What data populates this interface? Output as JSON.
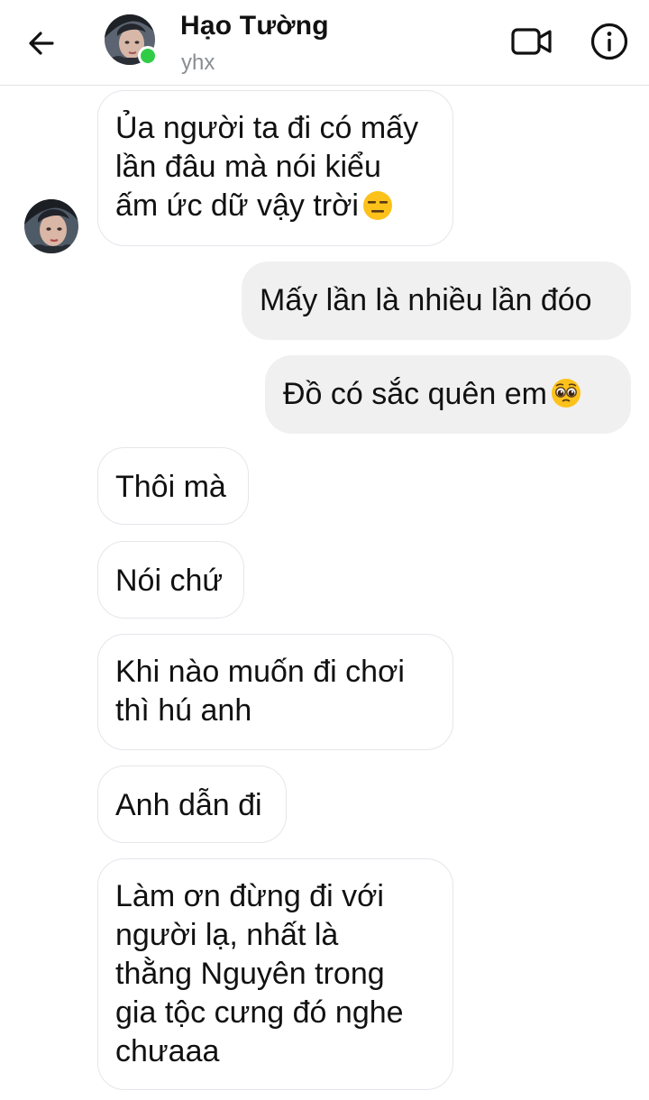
{
  "header": {
    "contact_name": "Hạo Tường",
    "contact_subtitle": "yhx",
    "online": true
  },
  "icons": {
    "back": "arrow-left",
    "video": "video-camera",
    "info": "info-circle"
  },
  "colors": {
    "online": "#31cc46",
    "incoming_bubble": "#ffffff",
    "outgoing_bubble": "#f0f0f0"
  },
  "messages": [
    {
      "sender": "them",
      "lines": [
        "Ủa người ta đi có mấy",
        "lần đâu mà nói kiểu",
        "ấm ức dữ vậy trời"
      ],
      "emoji": "expressionless-face"
    },
    {
      "sender": "me",
      "lines": [
        "Mấy lần là nhiều lần đóo"
      ]
    },
    {
      "sender": "me",
      "lines": [
        "Đồ có sắc quên em"
      ],
      "emoji": "pleading-face"
    },
    {
      "sender": "them",
      "lines": [
        "Thôi mà"
      ]
    },
    {
      "sender": "them",
      "lines": [
        "Nói chứ"
      ]
    },
    {
      "sender": "them",
      "lines": [
        "Khi nào muốn đi chơi",
        "thì hú anh"
      ]
    },
    {
      "sender": "them",
      "lines": [
        "Anh dẫn đi"
      ]
    },
    {
      "sender": "them",
      "lines": [
        "Làm ơn đừng đi với",
        "người lạ, nhất là",
        "thằng Nguyên trong",
        "gia tộc cưng đó nghe",
        "chưaaa"
      ]
    }
  ]
}
